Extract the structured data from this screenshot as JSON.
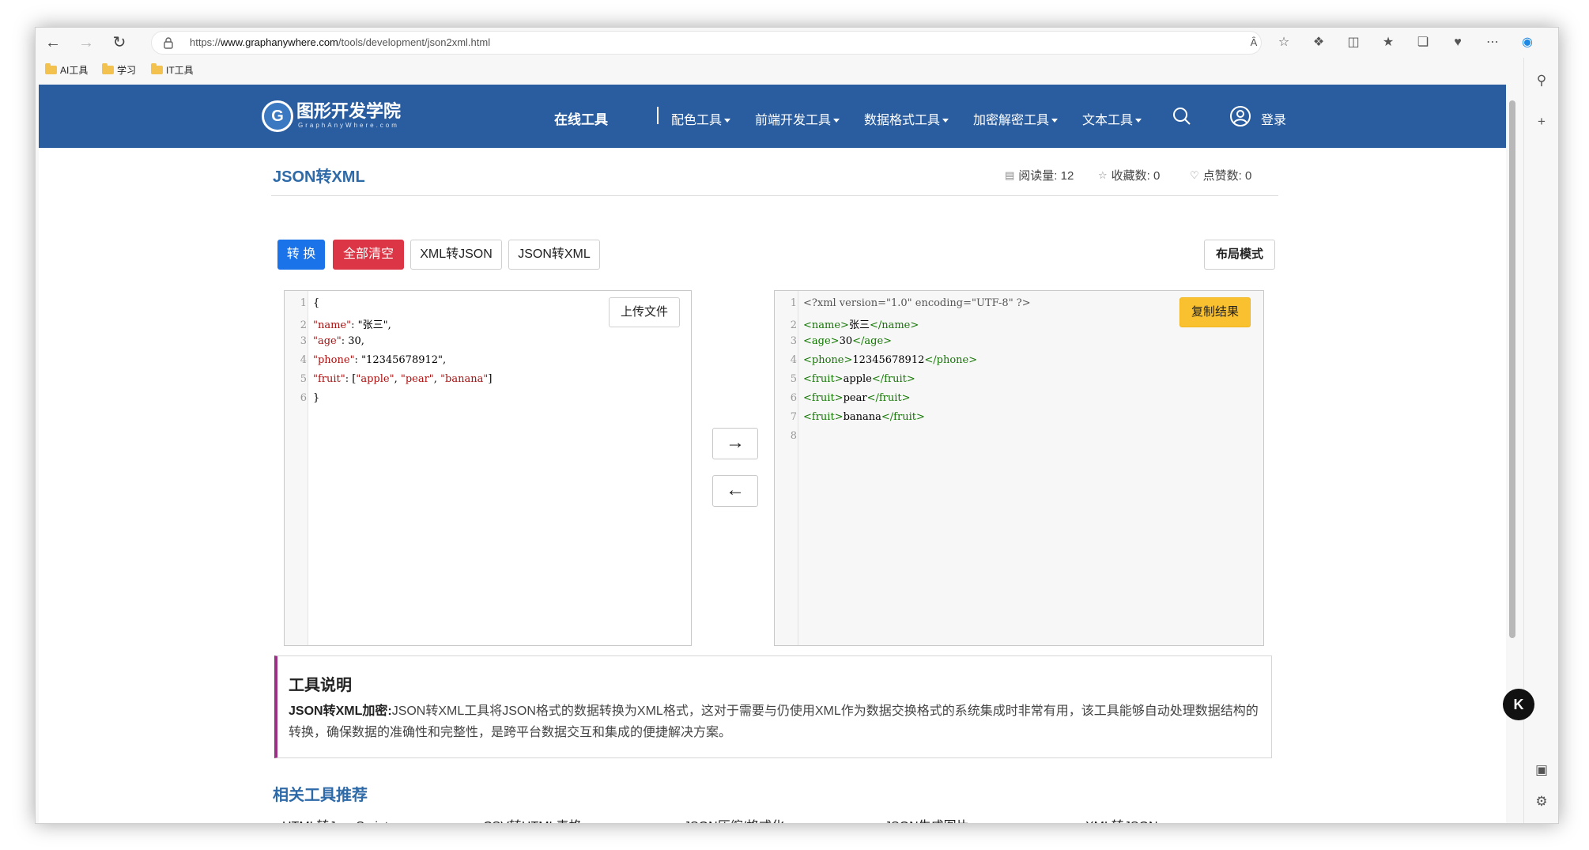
{
  "browser": {
    "url_prefix": "https://",
    "url_domain": "www.graphanywhere.com",
    "url_path": "/tools/development/json2xml.html",
    "bookmarks": [
      "AI工具",
      "学习",
      "IT工具"
    ]
  },
  "header": {
    "logo_title": "图形开发学院",
    "logo_sub": "GraphAnyWhere.com",
    "logo_letter": "G",
    "online_tools": "在线工具",
    "menus": [
      "配色工具",
      "前端开发工具",
      "数据格式工具",
      "加密解密工具",
      "文本工具"
    ],
    "login": "登录"
  },
  "tool": {
    "title": "JSON转XML",
    "read_label": "阅读量: 12",
    "fav_label": "收藏数: 0",
    "like_label": "点赞数: 0"
  },
  "toolbar": {
    "convert": "转 换",
    "clear_all": "全部清空",
    "xml_to_json": "XML转JSON",
    "json_to_xml": "JSON转XML",
    "layout_mode": "布局模式"
  },
  "input_editor": {
    "upload": "上传文件",
    "lines": [
      {
        "num": "1",
        "text": "{"
      },
      {
        "num": "2",
        "text": "\"name\": \"张三\","
      },
      {
        "num": "3",
        "text": "\"age\": 30,"
      },
      {
        "num": "4",
        "text": "\"phone\": \"12345678912\","
      },
      {
        "num": "5",
        "text": "\"fruit\": [\"apple\", \"pear\", \"banana\"]"
      },
      {
        "num": "6",
        "text": "}"
      }
    ]
  },
  "output_editor": {
    "copy": "复制结果",
    "lines": [
      {
        "num": "1",
        "text": "<?xml version=\"1.0\" encoding=\"UTF-8\" ?>"
      },
      {
        "num": "2",
        "text": "<name>张三</name>"
      },
      {
        "num": "3",
        "text": "<age>30</age>"
      },
      {
        "num": "4",
        "text": "<phone>12345678912</phone>"
      },
      {
        "num": "5",
        "text": "<fruit>apple</fruit>"
      },
      {
        "num": "6",
        "text": "<fruit>pear</fruit>"
      },
      {
        "num": "7",
        "text": "<fruit>banana</fruit>"
      },
      {
        "num": "8",
        "text": ""
      }
    ]
  },
  "arrows": {
    "right": "→",
    "left": "←"
  },
  "description": {
    "title": "工具说明",
    "lead": "JSON转XML加密:",
    "body": "JSON转XML工具将JSON格式的数据转换为XML格式，这对于需要与仍使用XML作为数据交换格式的系统集成时非常有用，该工具能够自动处理数据结构的转换，确保数据的准确性和完整性，是跨平台数据交互和集成的便捷解决方案。"
  },
  "related": {
    "title": "相关工具推荐",
    "links": [
      "HTML转JavaScript",
      "CSV转HTML表格",
      "JSON压缩/格式化",
      "JSON生成图片",
      "XML转JSON"
    ]
  },
  "float_button": "K"
}
